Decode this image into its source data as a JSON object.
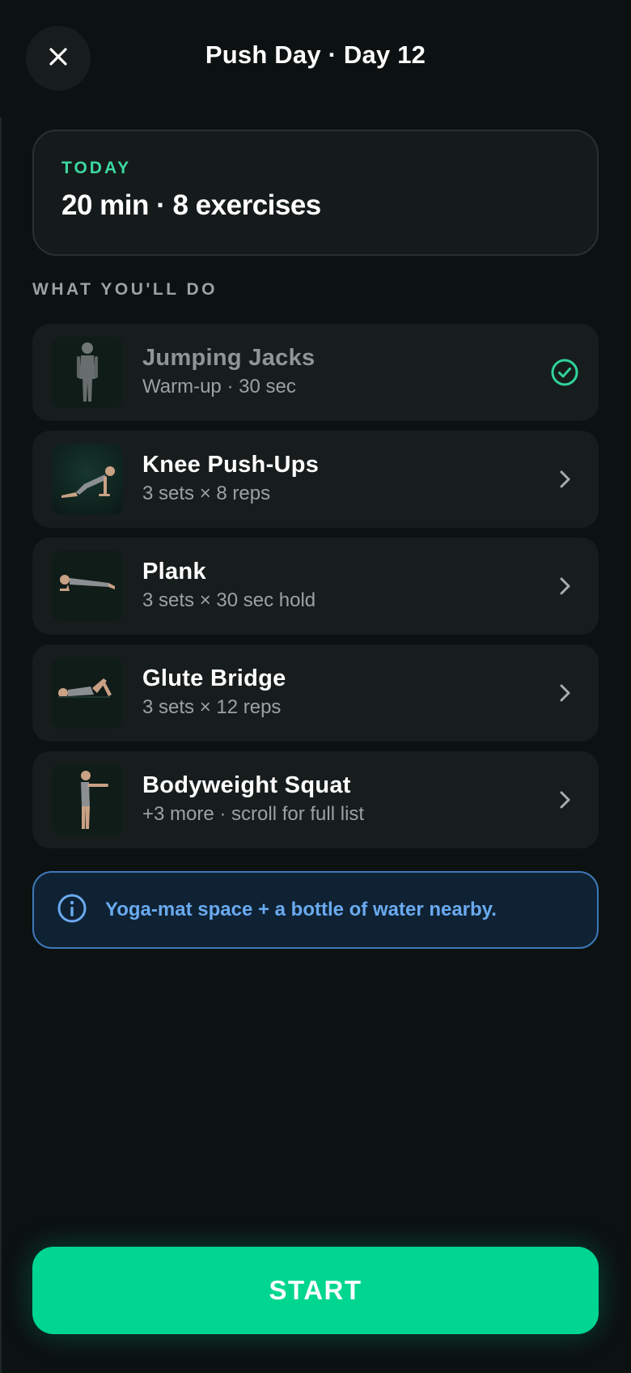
{
  "header": {
    "title": "Push Day · Day 12",
    "close_icon": "close-icon"
  },
  "summary": {
    "eyebrow": "TODAY",
    "text": "20 min · 8 exercises"
  },
  "section": {
    "label": "WHAT YOU'LL DO"
  },
  "exercises": [
    {
      "name": "Jumping Jacks",
      "detail": "Warm-up · 30 sec",
      "status": "completed",
      "icon": "check-circle-icon"
    },
    {
      "name": "Knee Push-Ups",
      "detail": "3 sets × 8 reps",
      "status": "pending",
      "icon": "chevron-right-icon"
    },
    {
      "name": "Plank",
      "detail": "3 sets × 30 sec hold",
      "status": "pending",
      "icon": "chevron-right-icon"
    },
    {
      "name": "Glute Bridge",
      "detail": "3 sets × 12 reps",
      "status": "pending",
      "icon": "chevron-right-icon"
    },
    {
      "name": "Bodyweight Squat",
      "detail": "+3 more · scroll for full list",
      "status": "pending",
      "icon": "chevron-right-icon"
    }
  ],
  "tip": {
    "icon": "info-icon",
    "text": "Yoga-mat space + a bottle of water nearby."
  },
  "start": {
    "label": "START"
  },
  "colors": {
    "background": "#0c1111",
    "card": "#171d1d",
    "accent": "#00d68f",
    "accent_text": "#3dd9a0",
    "tip_border": "#3d78b8",
    "tip_text": "#6aaaf0"
  }
}
